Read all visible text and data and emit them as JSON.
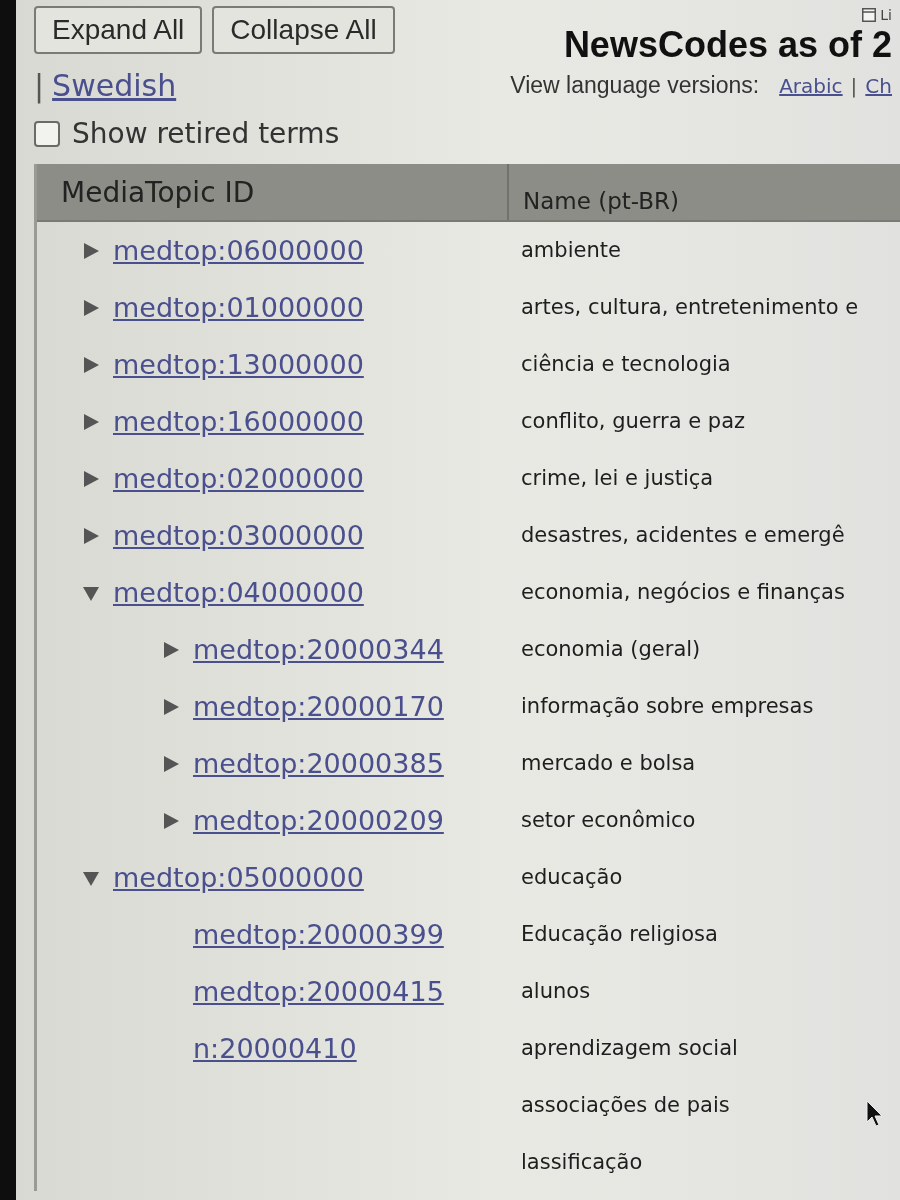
{
  "title": {
    "text": "NewsCodes as of 2",
    "corner_label": "Li"
  },
  "buttons": [
    "Expand All",
    "Collapse All"
  ],
  "language_links_continued": [
    {
      "kind": "separator",
      "text": "|"
    },
    {
      "kind": "link",
      "text": "Swedish"
    }
  ],
  "language_versions": {
    "label": "View language versions:",
    "items": [
      {
        "kind": "link",
        "text": "Arabic"
      },
      {
        "kind": "separator",
        "text": "|"
      },
      {
        "kind": "link",
        "text": "Ch"
      }
    ]
  },
  "retired_terms": {
    "label": "Show retired terms",
    "checked": false
  },
  "table": {
    "columns": [
      "MediaTopic ID",
      "Name (pt-BR)"
    ],
    "rows": [
      {
        "id": "medtop:06000000",
        "name": "ambiente",
        "expanded": false
      },
      {
        "id": "medtop:01000000",
        "name": "artes, cultura, entretenimento e",
        "expanded": false
      },
      {
        "id": "medtop:13000000",
        "name": "ciência e tecnologia",
        "expanded": false
      },
      {
        "id": "medtop:16000000",
        "name": "conflito, guerra e paz",
        "expanded": false
      },
      {
        "id": "medtop:02000000",
        "name": "crime, lei e justiça",
        "expanded": false
      },
      {
        "id": "medtop:03000000",
        "name": "desastres, acidentes e emergê",
        "expanded": false
      },
      {
        "id": "medtop:04000000",
        "name": "economia, negócios e finanças",
        "expanded": true,
        "children": [
          {
            "id": "medtop:20000344",
            "name": "economia (geral)",
            "expanded": false
          },
          {
            "id": "medtop:20000170",
            "name": "informação sobre empresas",
            "expanded": false
          },
          {
            "id": "medtop:20000385",
            "name": "mercado e bolsa",
            "expanded": false
          },
          {
            "id": "medtop:20000209",
            "name": "setor econômico",
            "expanded": false
          }
        ]
      },
      {
        "id": "medtop:05000000",
        "name": "educação",
        "expanded": true,
        "children": [
          {
            "id": "medtop:20000399",
            "name": "Educação religiosa"
          },
          {
            "id": "medtop:20000415",
            "name": "alunos"
          },
          {
            "id": "n:20000410",
            "name": "aprendizagem social"
          },
          {
            "name": "associações de pais"
          },
          {
            "name": "lassificação"
          }
        ]
      }
    ]
  }
}
